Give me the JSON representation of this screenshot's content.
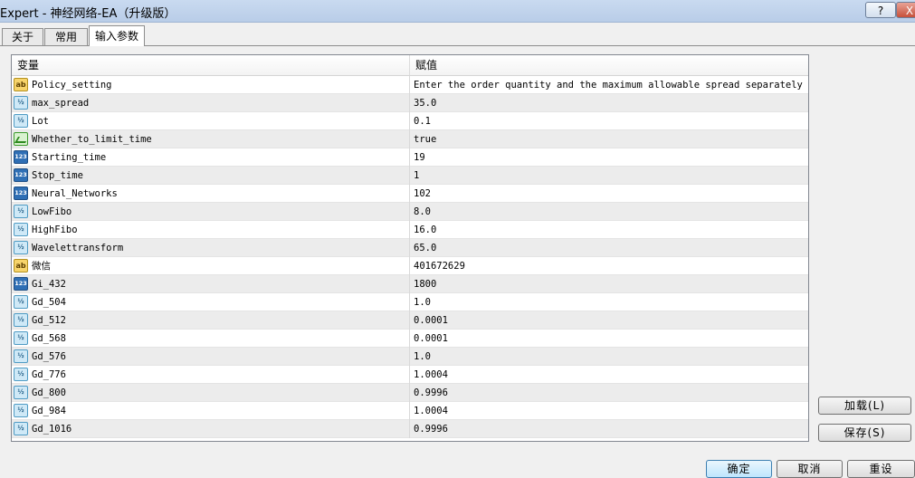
{
  "window": {
    "title": "Expert - 神经网络-EA（升级版）",
    "help_label": "?",
    "close_label": "X"
  },
  "tabs": [
    {
      "label": "关于"
    },
    {
      "label": "常用"
    },
    {
      "label": "输入参数",
      "active": true
    }
  ],
  "table": {
    "headers": {
      "name": "变量",
      "value": "赋值"
    },
    "rows": [
      {
        "icon": "ab",
        "name": "Policy_setting",
        "value": "Enter the order quantity and the maximum allowable spread separately ..."
      },
      {
        "icon": "v2",
        "name": "max_spread",
        "value": "35.0"
      },
      {
        "icon": "v2",
        "name": "Lot",
        "value": "0.1"
      },
      {
        "icon": "bool",
        "name": "Whether_to_limit_time",
        "value": "true"
      },
      {
        "icon": "123",
        "name": "Starting_time",
        "value": "19"
      },
      {
        "icon": "123",
        "name": "Stop_time",
        "value": "1"
      },
      {
        "icon": "123",
        "name": "Neural_Networks",
        "value": "102"
      },
      {
        "icon": "v2",
        "name": "LowFibo",
        "value": "8.0"
      },
      {
        "icon": "v2",
        "name": "HighFibo",
        "value": "16.0"
      },
      {
        "icon": "v2",
        "name": "Wavelettransform",
        "value": "65.0"
      },
      {
        "icon": "ab",
        "name": "微信",
        "value": "401672629"
      },
      {
        "icon": "123",
        "name": "Gi_432",
        "value": "1800"
      },
      {
        "icon": "v2",
        "name": "Gd_504",
        "value": "1.0"
      },
      {
        "icon": "v2",
        "name": "Gd_512",
        "value": "0.0001"
      },
      {
        "icon": "v2",
        "name": "Gd_568",
        "value": "0.0001"
      },
      {
        "icon": "v2",
        "name": "Gd_576",
        "value": "1.0"
      },
      {
        "icon": "v2",
        "name": "Gd_776",
        "value": "1.0004"
      },
      {
        "icon": "v2",
        "name": "Gd_800",
        "value": "0.9996"
      },
      {
        "icon": "v2",
        "name": "Gd_984",
        "value": "1.0004"
      },
      {
        "icon": "v2",
        "name": "Gd_1016",
        "value": "0.9996"
      }
    ]
  },
  "buttons": {
    "load": "加载(L)",
    "save": "保存(S)",
    "ok": "确定",
    "cancel": "取消",
    "reset": "重设"
  },
  "icons": {
    "ab": "string-type-icon",
    "v2": "double-type-icon",
    "123": "integer-type-icon",
    "bool": "bool-type-icon"
  }
}
